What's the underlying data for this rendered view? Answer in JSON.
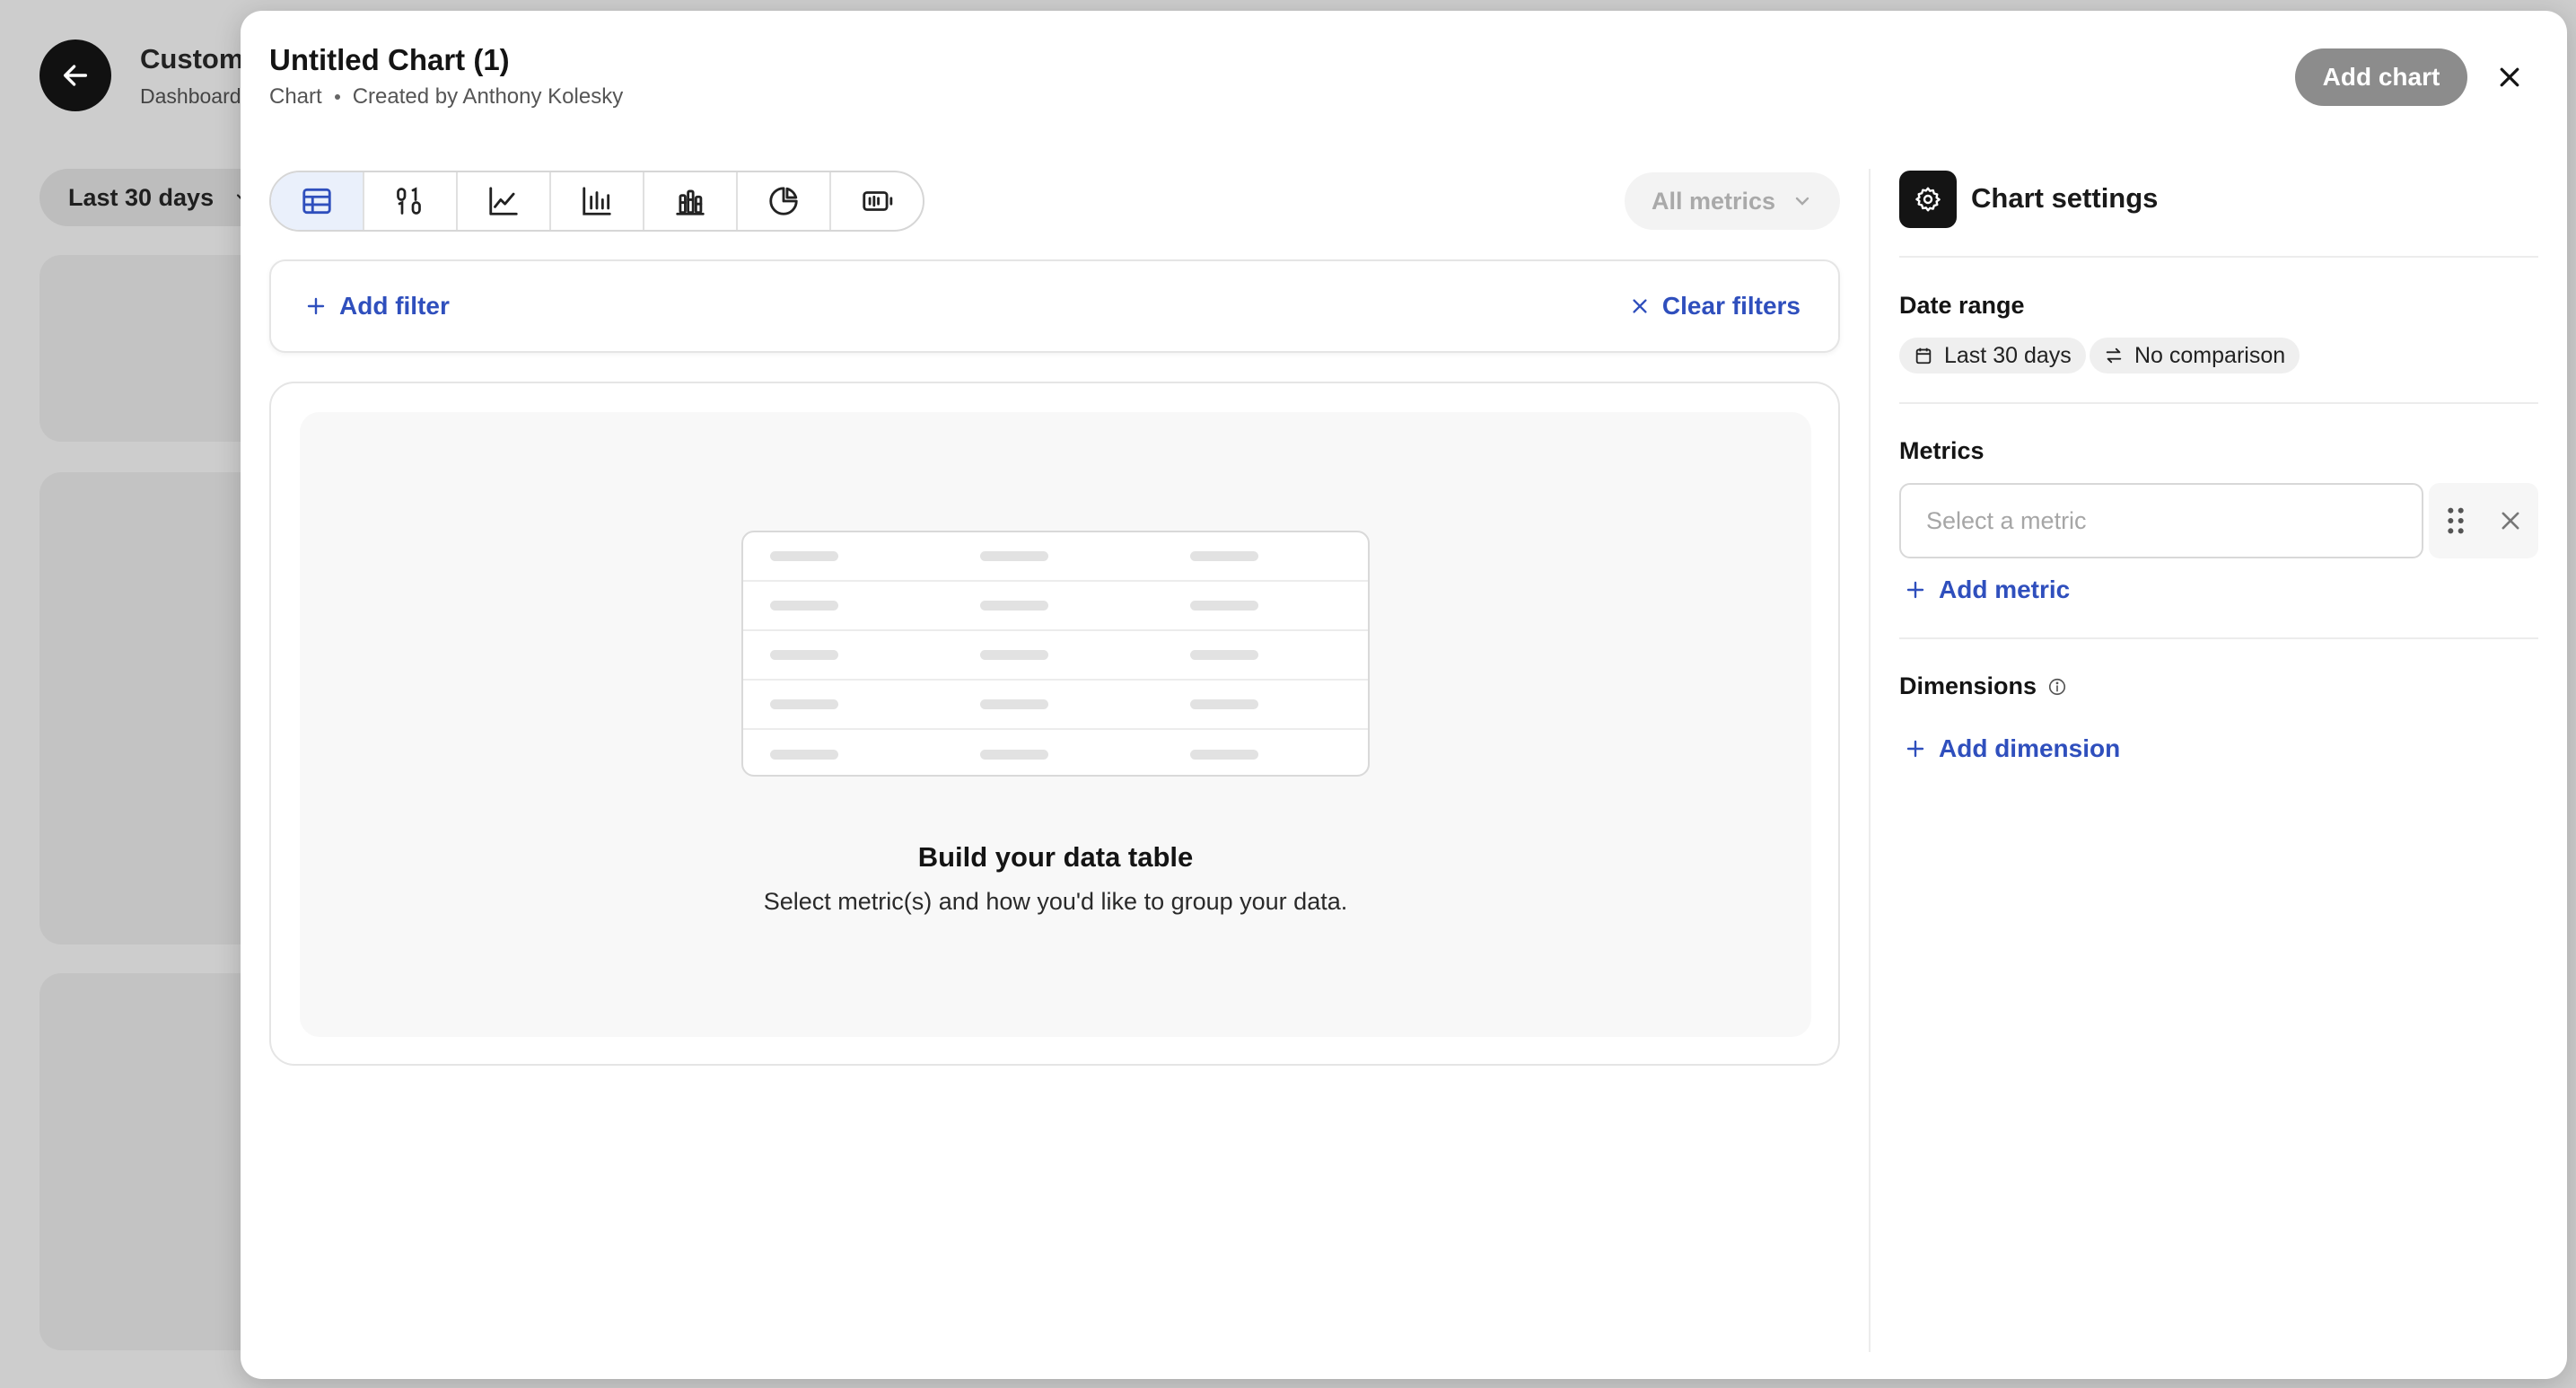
{
  "background": {
    "title": "Custom",
    "subtitle": "Dashboard",
    "date_range": "Last 30 days"
  },
  "header": {
    "title": "Untitled Chart (1)",
    "type_label": "Chart",
    "created_by": "Created by Anthony Kolesky",
    "add_chart_label": "Add chart"
  },
  "toolbar": {
    "chart_types": [
      "table",
      "number",
      "line",
      "bar",
      "stacked-bar",
      "pie",
      "funnel"
    ],
    "active": "table",
    "metrics_dropdown": "All metrics"
  },
  "filters": {
    "add_label": "Add filter",
    "clear_label": "Clear filters"
  },
  "preview": {
    "empty_title": "Build your data table",
    "empty_subtitle": "Select metric(s) and how you'd like to group your data."
  },
  "settings": {
    "title": "Chart settings",
    "date_range": {
      "label": "Date range",
      "value": "Last 30 days",
      "comparison": "No comparison"
    },
    "metrics": {
      "label": "Metrics",
      "placeholder": "Select a metric",
      "add_label": "Add metric"
    },
    "dimensions": {
      "label": "Dimensions",
      "add_label": "Add dimension"
    }
  },
  "colors": {
    "accent_link": "#2f4fbd",
    "active_tab": "#eaf0fb",
    "disabled_button": "#8c8c8c"
  }
}
